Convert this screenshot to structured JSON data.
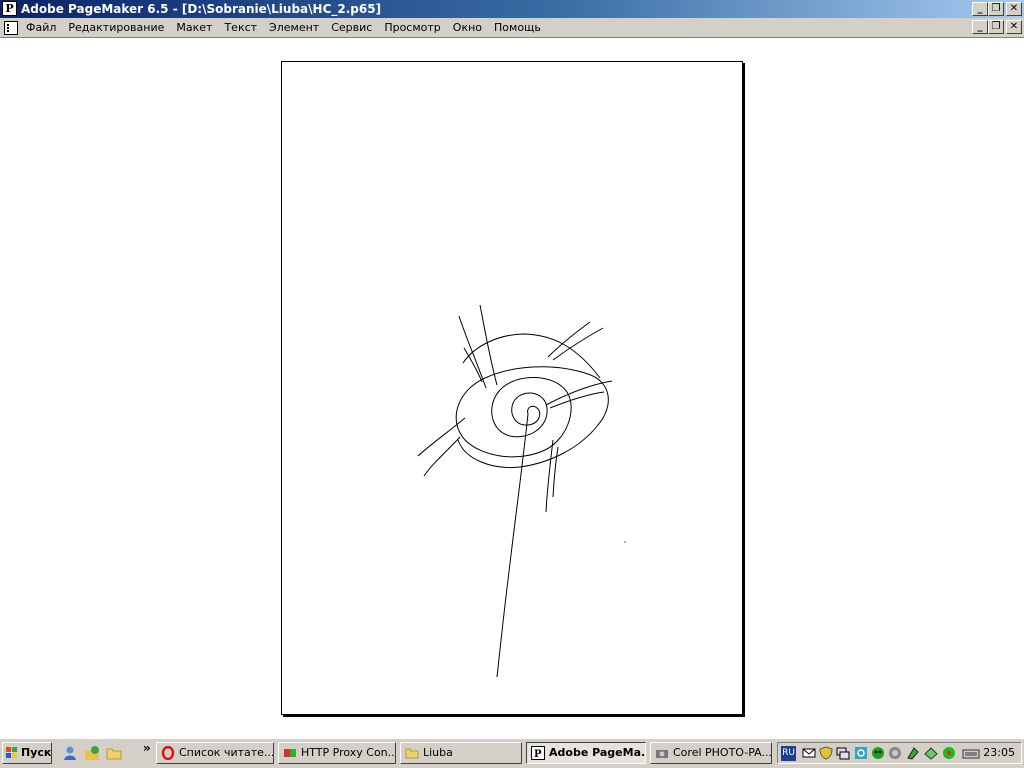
{
  "window": {
    "title": "Adobe PageMaker 6.5 - [D:\\Sobranie\\Liuba\\HC_2.p65]",
    "app_icon_letter": "P",
    "controls": [
      "minimize",
      "restore",
      "close"
    ]
  },
  "menubar": {
    "items": [
      "Файл",
      "Редактирование",
      "Макет",
      "Текст",
      "Элемент",
      "Сервис",
      "Просмотр",
      "Окно",
      "Помощь"
    ]
  },
  "taskbar": {
    "start_label": "Пуск",
    "quick_launch": [
      "messenger-icon",
      "explorer-icon",
      "folder-icon"
    ],
    "chevron": "»",
    "tasks": [
      {
        "label": "Список читате...",
        "icon": "opera-icon",
        "active": false
      },
      {
        "label": "HTTP Proxy Con...",
        "icon": "proxy-icon",
        "active": false
      },
      {
        "label": "Liuba",
        "icon": "folder-icon",
        "active": false
      },
      {
        "label": "Adobe PageMa...",
        "icon": "pagemaker-icon",
        "active": true
      },
      {
        "label": "Corel PHOTO-PA...",
        "icon": "camera-icon",
        "active": false
      }
    ],
    "tray": {
      "language": "RU",
      "icons": [
        "mail-icon",
        "shield-icon",
        "network-icon",
        "sync-icon",
        "globe-icon",
        "volume-icon",
        "antivirus-icon",
        "network2-icon",
        "icq-icon",
        "keyboard-icon"
      ],
      "clock": "23:05"
    }
  }
}
